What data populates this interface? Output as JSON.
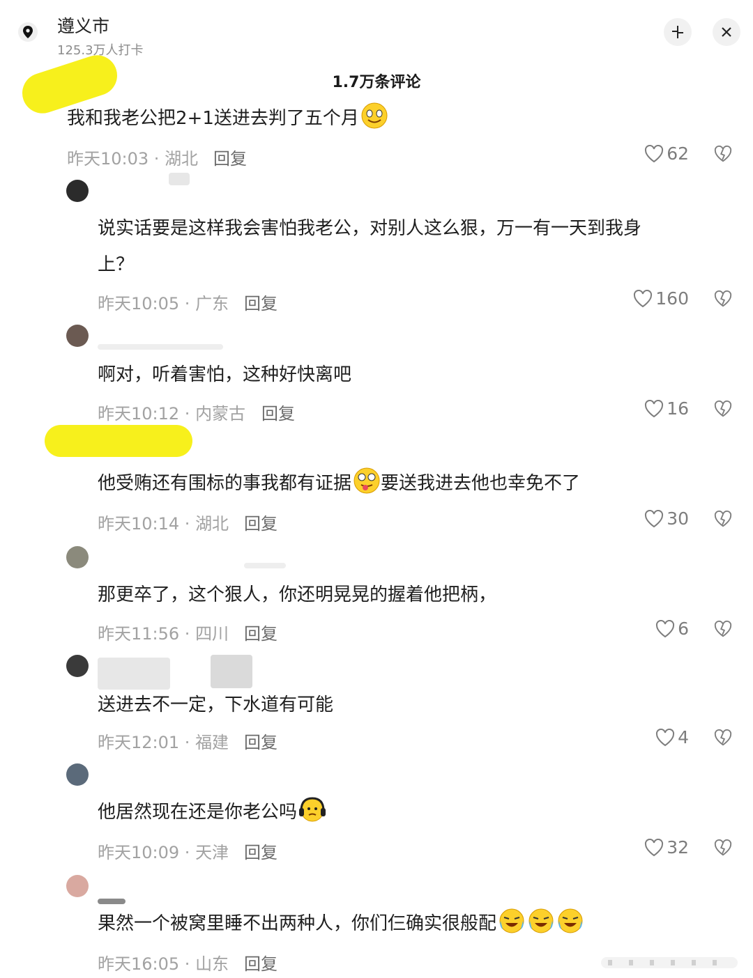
{
  "header": {
    "location_name": "遵义市",
    "checkins": "125.3万人打卡"
  },
  "comment_count": "1.7万条评论",
  "comments": [
    {
      "text": "我和我老公把2+1送进去判了五个月",
      "time": "昨天10:03",
      "region": "湖北",
      "reply": "回复",
      "likes": "62"
    },
    {
      "text_line1": "说实话要是这样我会害怕我老公，对别人这么狠，万一有一天到我身",
      "text_line2": "上？",
      "time": "昨天10:05",
      "region": "广东",
      "reply": "回复",
      "likes": "160"
    },
    {
      "text": "啊对，听着害怕，这种好快离吧",
      "time": "昨天10:12",
      "region": "内蒙古",
      "reply": "回复",
      "likes": "16"
    },
    {
      "text_a": "他受贿还有围标的事我都有证据",
      "text_b": "要送我进去他也幸免不了",
      "time": "昨天10:14",
      "region": "湖北",
      "reply": "回复",
      "likes": "30"
    },
    {
      "text": "那更卒了，这个狠人，你还明晃晃的握着他把柄，",
      "time": "昨天11:56",
      "region": "四川",
      "reply": "回复",
      "likes": "6"
    },
    {
      "text": "送进去不一定，下水道有可能",
      "time": "昨天12:01",
      "region": "福建",
      "reply": "回复",
      "likes": "4"
    },
    {
      "text": "他居然现在还是你老公吗",
      "time": "昨天10:09",
      "region": "天津",
      "reply": "回复",
      "likes": "32"
    },
    {
      "text": "果然一个被窝里睡不出两种人，你们仨确实很般配",
      "time": "昨天16:05",
      "region": "山东",
      "reply": "回复",
      "likes": ""
    }
  ],
  "colors": {
    "highlight": "#f7f01c",
    "meta": "#a2a2a2"
  },
  "icons": [
    "location-pin-icon",
    "collapse-icon",
    "close-icon",
    "heart-icon",
    "broken-heart-icon"
  ]
}
